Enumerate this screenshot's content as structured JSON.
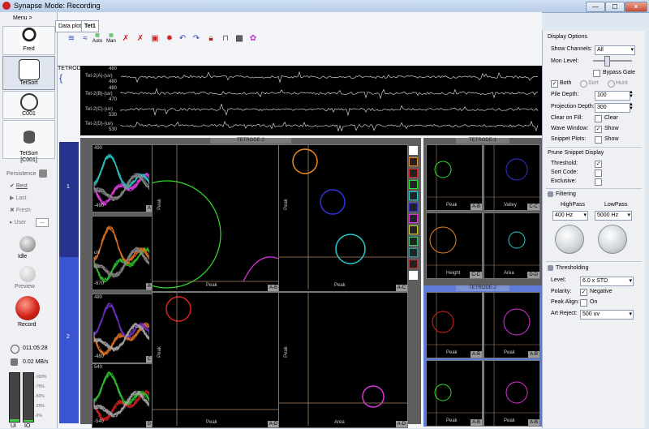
{
  "window": {
    "app": "Synapse",
    "mode": "Mode: Recording",
    "min": "—",
    "max": "☐",
    "close": "✕"
  },
  "left": {
    "menu": "Menu >",
    "user": "Fred",
    "tetsort": "TetSort",
    "c001": "C001",
    "tetsort2": "TetSort\n[C001]",
    "persistence": "Persistence",
    "best": "Best",
    "last": "Last",
    "fresh": "Fresh",
    "user_lbl": "User",
    "user_btn": "...",
    "idle": "Idle",
    "preview": "Preview",
    "record": "Record",
    "time": "011:05:28",
    "rate": "0.02 MB/s",
    "meter_ticks": [
      "-100%",
      "-75%",
      "-50%",
      "-25%",
      "-0%"
    ],
    "meter_ui": "UI",
    "meter_io": "IO"
  },
  "center": {
    "tabs": [
      "Data plot",
      "Tet1"
    ],
    "toolbar_icons": [
      "waveform-icon",
      "wave-fit-icon",
      "auto-icon",
      "manual-icon",
      "clear-1-icon",
      "clear-2-icon",
      "clear-3-icon",
      "clear-4-icon",
      "undo-icon",
      "redo-icon",
      "lock-icon",
      "unlock-icon",
      "grid-icon",
      "color-icon"
    ],
    "auto": "Auto",
    "man": "Man",
    "strip_title": "TETRODE",
    "channels": [
      {
        "name": "Tet-2(A)-(uv)",
        "top": "480",
        "bot": "480"
      },
      {
        "name": "Tet-2(B)-(uv)",
        "top": "480",
        "bot": "470"
      },
      {
        "name": "Tet-2(C)-(uv)",
        "top": "470",
        "bot": "530"
      },
      {
        "name": "Tet-2(D)-(uv)",
        "top": "530",
        "bot": ""
      }
    ],
    "group1": "1",
    "group2": "2",
    "tetrode2": "TETRODE-2",
    "tetrode1": "TETRODE-1",
    "tetrode2b": "TETRODE-2",
    "wave_labels": {
      "top": "490",
      "uv": "uV",
      "ab": "A",
      "b": "B",
      "c": "C",
      "d": "D",
      "bot1": "-490",
      "bot2": "-670",
      "top3": "480",
      "bot3": "-480",
      "top4": "540",
      "bot4": "-540"
    },
    "scatter": {
      "peak": "Peak",
      "area": "Area",
      "height": "Height",
      "valley": "Valley",
      "ab": "A-B",
      "ac": "A-C",
      "ad": "A-D",
      "cc": "C-C",
      "cd": "C-D",
      "dd": "D-D"
    }
  },
  "right": {
    "display_options": "Display Options",
    "show_channels": "Show Channels:",
    "show_channels_val": "All",
    "mon_level": "Mon Level:",
    "bypass": "Bypass Gate",
    "both": "Both",
    "sort": "Sort",
    "hunt": "Hunt",
    "pile_depth": "Pile Depth:",
    "pile_val": "100",
    "proj_depth": "Projection Depth:",
    "proj_val": "300",
    "clear_fill": "Clear on Fill:",
    "clear": "Clear",
    "wave_window": "Wave Window:",
    "show": "Show",
    "snippet_plots": "Snippet Plots:",
    "show2": "Show",
    "prune": "Prune Snippet Display",
    "threshold": "Threshold:",
    "sort_code": "Sort Code:",
    "exclusive": "Exclusive:",
    "filtering": "Filtering",
    "highpass": "HighPass",
    "lowpass": "LowPass",
    "hp_val": "400 Hz",
    "lp_val": "5000 Hz",
    "thresholding": "Thresholding",
    "level": "Level:",
    "level_val": "6.0 x STD",
    "polarity": "Polarity:",
    "negative": "Negative",
    "peak_align": "Peak Align:",
    "on": "On",
    "art_reject": "Art Reject:",
    "art_val": "500 uv"
  },
  "colors": {
    "accent": "#3a66d8",
    "sel": "#4a6fc8"
  }
}
